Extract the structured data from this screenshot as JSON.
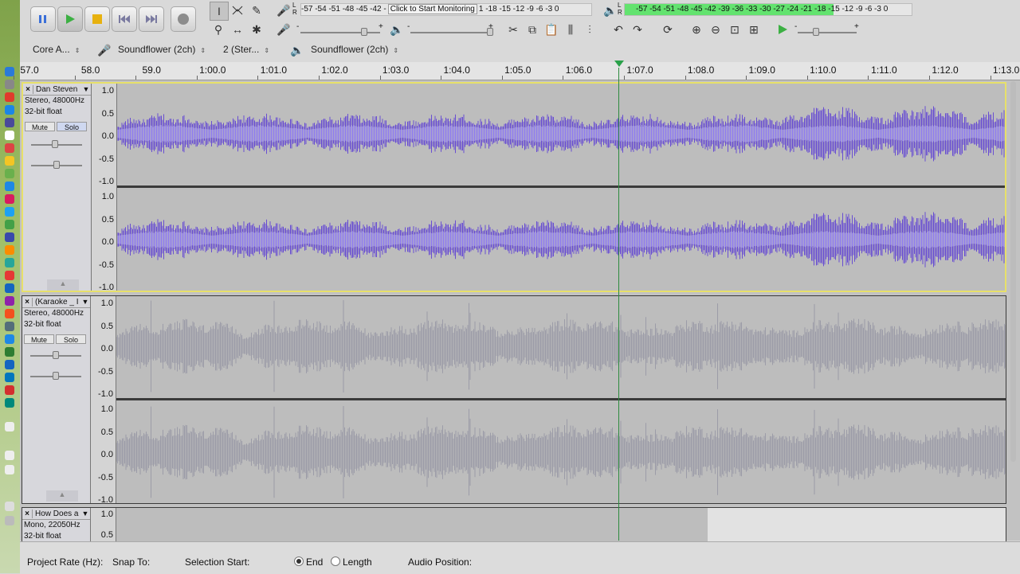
{
  "toolbar": {
    "transport": [
      "pause-button",
      "play-button",
      "stop-button",
      "skip-start-button",
      "skip-end-button",
      "record-button"
    ],
    "tools": [
      "selection-tool",
      "envelope-tool",
      "draw-tool",
      "zoom-tool",
      "timeshift-tool",
      "multi-tool"
    ],
    "rec_meter_scale": "-57 -54 -51 -48 -45 -42 -",
    "rec_meter_prompt": "Click to Start Monitoring",
    "rec_meter_scale_right": "1 -18 -15 -12  -9  -6  -3  0",
    "play_meter_scale": "-57 -54 -51 -48 -45 -42 -39 -36 -33 -30 -27 -24 -21 -18 -15 -12  -9  -6  -3  0",
    "meter_lr": [
      "L",
      "R"
    ],
    "slider_minus": "-",
    "slider_plus": "+"
  },
  "devices": {
    "host": "Core A...",
    "recording_device": "Soundflower (2ch)",
    "channels": "2 (Ster...",
    "playback_device": "Soundflower (2ch)"
  },
  "ruler": {
    "labels": [
      "57.0",
      "58.0",
      "59.0",
      "1:00.0",
      "1:01.0",
      "1:02.0",
      "1:03.0",
      "1:04.0",
      "1:05.0",
      "1:06.0",
      "1:07.0",
      "1:08.0",
      "1:09.0",
      "1:10.0",
      "1:11.0",
      "1:12.0",
      "1:13.0"
    ]
  },
  "tracks": [
    {
      "name": "Dan Steven",
      "format": "Stereo, 48000Hz",
      "bits": "32-bit float",
      "mute": "Mute",
      "solo": "Solo",
      "color": "#5a3bd6",
      "scale": [
        "1.0",
        "0.5",
        "0.0",
        "-0.5",
        "-1.0"
      ]
    },
    {
      "name": "(Karaoke _ I",
      "format": "Stereo, 48000Hz",
      "bits": "32-bit float",
      "mute": "Mute",
      "solo": "Solo",
      "color": "#9a9aa6",
      "scale": [
        "1.0",
        "0.5",
        "0.0",
        "-0.5",
        "-1.0"
      ]
    },
    {
      "name": "How Does a",
      "format": "Mono, 22050Hz",
      "bits": "32-bit float",
      "scale": [
        "1.0",
        "0.5"
      ]
    }
  ],
  "selection_bar": {
    "project_rate_label": "Project Rate (Hz):",
    "snap_to_label": "Snap To:",
    "selection_start_label": "Selection Start:",
    "end_label": "End",
    "length_label": "Length",
    "audio_position_label": "Audio Position:"
  }
}
